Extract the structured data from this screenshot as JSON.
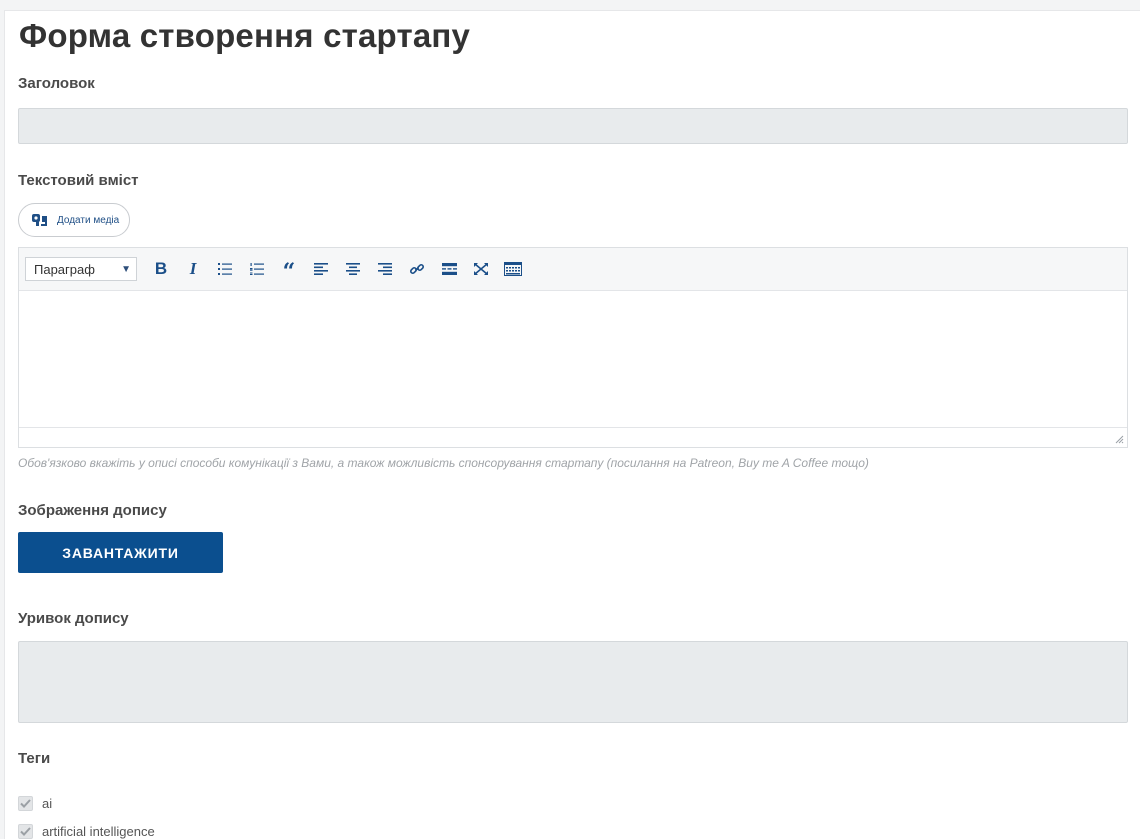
{
  "form": {
    "title": "Форма створення стартапу",
    "title_label": "Заголовок",
    "content_label": "Текстовий вміст",
    "add_media_label": "Додати медіа",
    "format_select_value": "Параграф",
    "hint": "Обов'язково вкажіть у описі способи комунікації з Вами, а також можливість спонсорування стартапу (посилання на Patreon, Buy me A Coffee тощо)",
    "image_label": "Зображення допису",
    "upload_label": "ЗАВАНТАЖИТИ",
    "excerpt_label": "Уривок допису",
    "tags_label": "Теги",
    "tags": [
      {
        "label": "ai",
        "checked": true
      },
      {
        "label": "artificial intelligence",
        "checked": true
      }
    ]
  },
  "toolbar_icons": [
    "bold-icon",
    "italic-icon",
    "bullet-list-icon",
    "numbered-list-icon",
    "blockquote-icon",
    "align-left-icon",
    "align-center-icon",
    "align-right-icon",
    "link-icon",
    "read-more-icon",
    "fullscreen-icon",
    "toolbar-toggle-icon"
  ],
  "colors": {
    "accent": "#0b4f8f",
    "input_bg": "#e8ebed",
    "icon": "#1b4f89",
    "hint": "#a0a4a8"
  }
}
